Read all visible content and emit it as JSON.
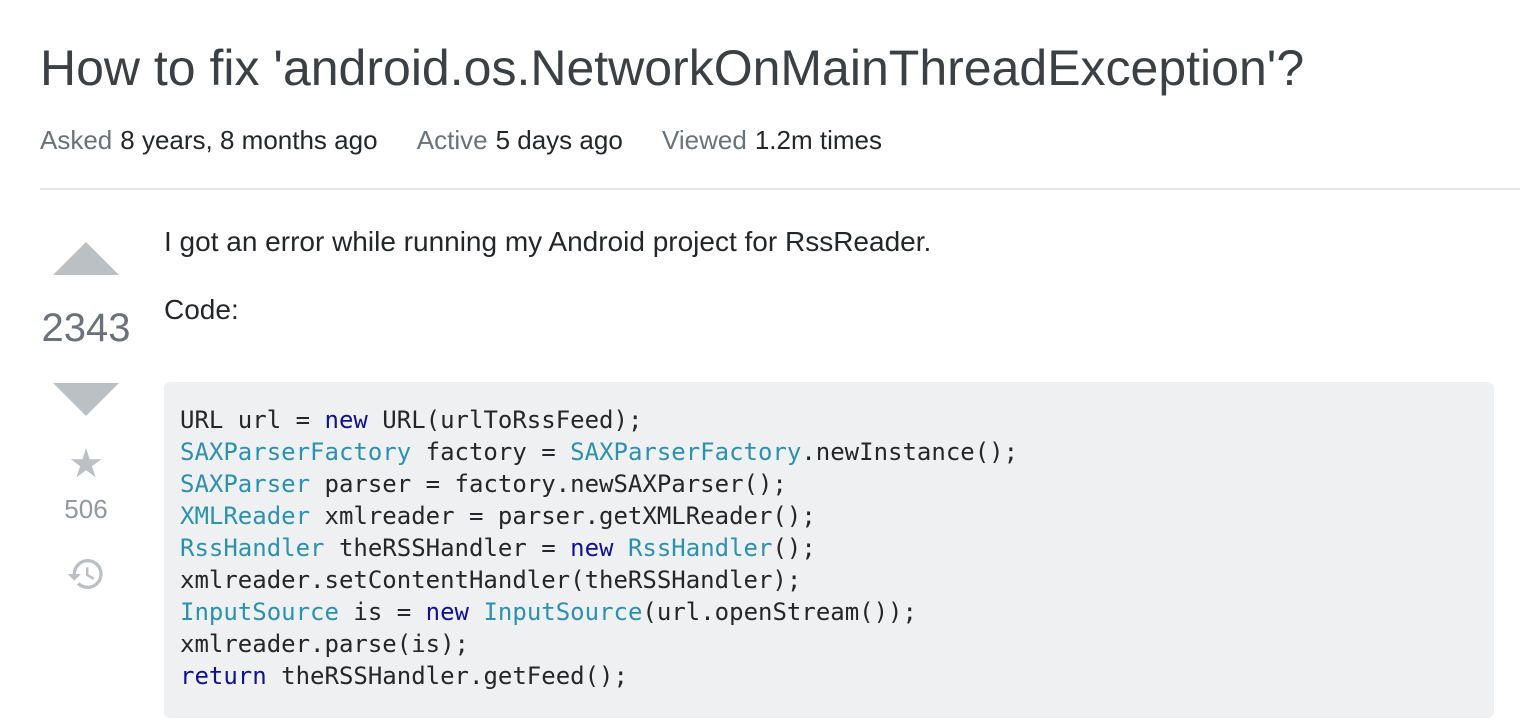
{
  "question": {
    "title": "How to fix 'android.os.NetworkOnMainThreadException'?",
    "meta": {
      "asked_label": "Asked",
      "asked_value": "8 years, 8 months ago",
      "active_label": "Active",
      "active_value": "5 days ago",
      "viewed_label": "Viewed",
      "viewed_value": "1.2m times"
    },
    "votes": {
      "score": "2343",
      "favorites": "506",
      "upvote_icon": "triangle-up-icon",
      "downvote_icon": "triangle-down-icon",
      "favorite_icon": "star-icon",
      "history_icon": "history-icon"
    },
    "body": {
      "paragraph_1": "I got an error while running my Android project for RssReader.",
      "paragraph_2": "Code:",
      "code_lines": [
        [
          {
            "t": "URL url = ",
            "c": "plain"
          },
          {
            "t": "new",
            "c": "kw"
          },
          {
            "t": " URL(urlToRssFeed);",
            "c": "plain"
          }
        ],
        [
          {
            "t": "SAXParserFactory",
            "c": "ty"
          },
          {
            "t": " factory = ",
            "c": "plain"
          },
          {
            "t": "SAXParserFactory",
            "c": "ty"
          },
          {
            "t": ".newInstance();",
            "c": "plain"
          }
        ],
        [
          {
            "t": "SAXParser",
            "c": "ty"
          },
          {
            "t": " parser = factory.newSAXParser();",
            "c": "plain"
          }
        ],
        [
          {
            "t": "XMLReader",
            "c": "ty"
          },
          {
            "t": " xmlreader = parser.getXMLReader();",
            "c": "plain"
          }
        ],
        [
          {
            "t": "RssHandler",
            "c": "ty"
          },
          {
            "t": " theRSSHandler = ",
            "c": "plain"
          },
          {
            "t": "new",
            "c": "kw"
          },
          {
            "t": " ",
            "c": "plain"
          },
          {
            "t": "RssHandler",
            "c": "ty"
          },
          {
            "t": "();",
            "c": "plain"
          }
        ],
        [
          {
            "t": "xmlreader.setContentHandler(theRSSHandler);",
            "c": "plain"
          }
        ],
        [
          {
            "t": "InputSource",
            "c": "ty"
          },
          {
            "t": " is = ",
            "c": "plain"
          },
          {
            "t": "new",
            "c": "kw"
          },
          {
            "t": " ",
            "c": "plain"
          },
          {
            "t": "InputSource",
            "c": "ty"
          },
          {
            "t": "(url.openStream());",
            "c": "plain"
          }
        ],
        [
          {
            "t": "xmlreader.parse(is);",
            "c": "plain"
          }
        ],
        [
          {
            "t": "return",
            "c": "kw"
          },
          {
            "t": " theRSSHandler.getFeed();",
            "c": "plain"
          }
        ]
      ]
    }
  },
  "colors": {
    "keyword": "#101094",
    "type": "#2b91af",
    "code_background": "#eff0f1",
    "vote_arrow": "#bbc0c4"
  }
}
